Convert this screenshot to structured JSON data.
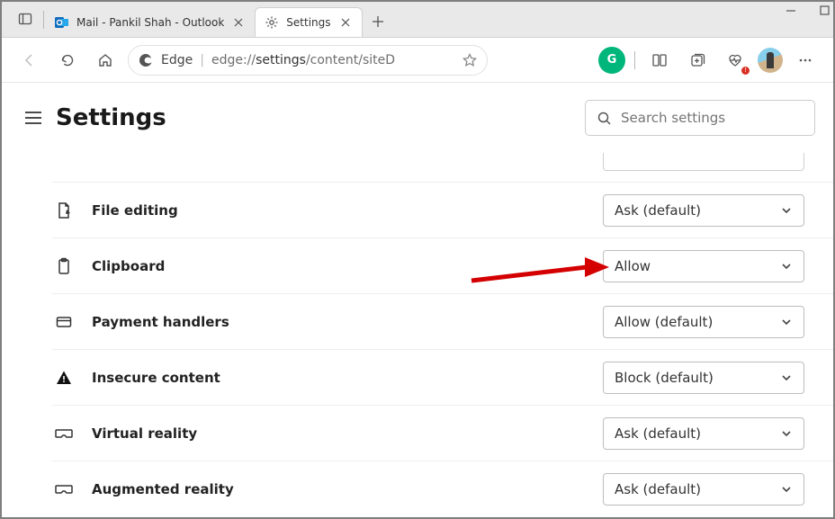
{
  "tabs": [
    {
      "title": "Mail - Pankil Shah - Outlook",
      "active": false
    },
    {
      "title": "Settings",
      "active": true
    }
  ],
  "address": {
    "edge_label": "Edge",
    "url_prefix": "edge://",
    "url_strong": "settings",
    "url_suffix": "/content/siteD"
  },
  "header": {
    "title": "Settings",
    "search_placeholder": "Search settings"
  },
  "rows": [
    {
      "icon": "file-edit",
      "label": "File editing",
      "value": "Ask (default)"
    },
    {
      "icon": "clipboard",
      "label": "Clipboard",
      "value": "Allow"
    },
    {
      "icon": "payment",
      "label": "Payment handlers",
      "value": "Allow (default)"
    },
    {
      "icon": "warning",
      "label": "Insecure content",
      "value": "Block (default)"
    },
    {
      "icon": "vr",
      "label": "Virtual reality",
      "value": "Ask (default)"
    },
    {
      "icon": "vr",
      "label": "Augmented reality",
      "value": "Ask (default)"
    }
  ]
}
